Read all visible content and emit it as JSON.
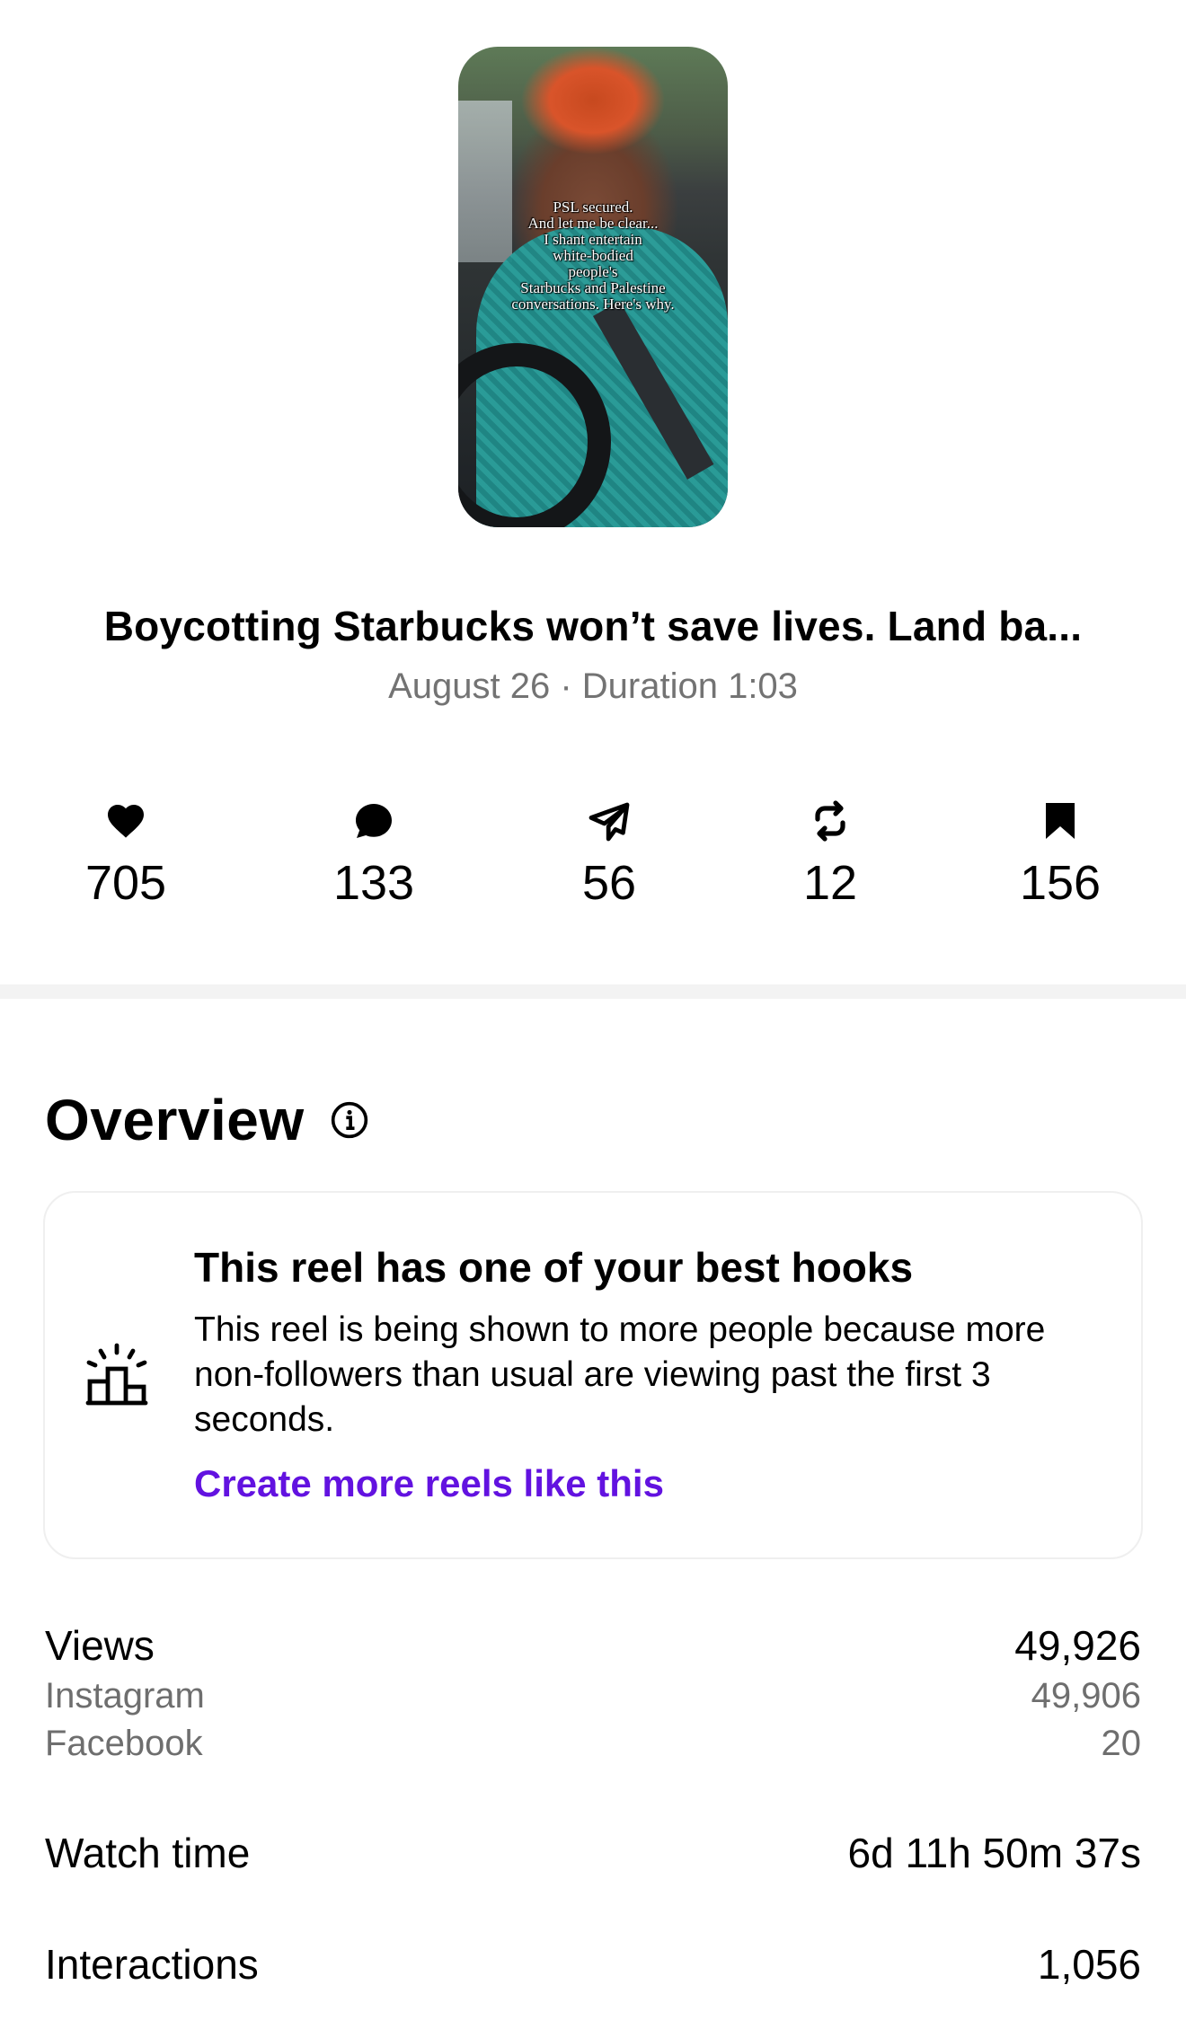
{
  "reel": {
    "caption_lines": [
      "PSL secured.",
      "And let me be clear...",
      "I shant entertain",
      "white-bodied",
      "people's",
      "Starbucks and Palestine",
      "conversations. Here's why."
    ],
    "title": "Boycotting Starbucks won’t save lives. Land ba...",
    "subtitle": "August 26 · Duration 1:03"
  },
  "stats": [
    {
      "icon": "heart-icon",
      "value": "705"
    },
    {
      "icon": "comment-icon",
      "value": "133"
    },
    {
      "icon": "share-icon",
      "value": "56"
    },
    {
      "icon": "repost-icon",
      "value": "12"
    },
    {
      "icon": "bookmark-icon",
      "value": "156"
    }
  ],
  "overview": {
    "heading": "Overview",
    "card": {
      "icon": "podium-sparkle-icon",
      "title": "This reel has one of your best hooks",
      "body": "This reel is being shown to more people because more non-followers than usual are viewing past the first 3 seconds.",
      "link": "Create more reels like this",
      "link_color": "#6212e0"
    }
  },
  "metrics": {
    "views": {
      "label": "Views",
      "value": "49,926"
    },
    "instagram": {
      "label": "Instagram",
      "value": "49,906"
    },
    "facebook": {
      "label": "Facebook",
      "value": "20"
    },
    "watch_time": {
      "label": "Watch time",
      "value": "6d 11h 50m 37s"
    },
    "interactions": {
      "label": "Interactions",
      "value": "1,056"
    }
  }
}
